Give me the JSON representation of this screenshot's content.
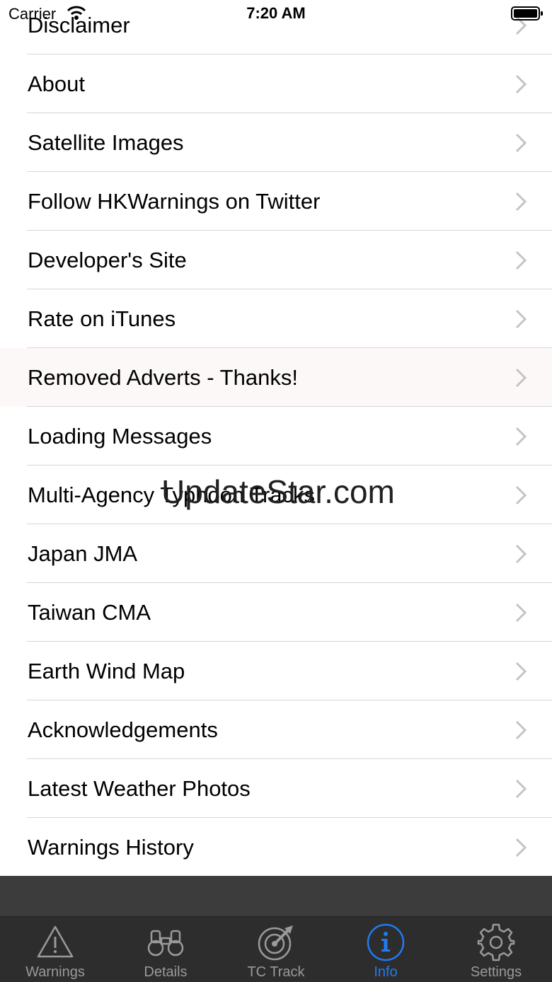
{
  "status_bar": {
    "carrier": "Carrier",
    "time": "7:20 AM"
  },
  "menu": {
    "items": [
      {
        "label": "Disclaimer"
      },
      {
        "label": "About"
      },
      {
        "label": "Satellite Images"
      },
      {
        "label": "Follow HKWarnings on Twitter"
      },
      {
        "label": "Developer's Site"
      },
      {
        "label": "Rate on iTunes"
      },
      {
        "label": "Removed Adverts - Thanks!"
      },
      {
        "label": "Loading Messages"
      },
      {
        "label": "Multi-Agency Typhoon Tracks"
      },
      {
        "label": "Japan JMA"
      },
      {
        "label": "Taiwan CMA"
      },
      {
        "label": "Earth Wind Map"
      },
      {
        "label": "Acknowledgements"
      },
      {
        "label": "Latest Weather Photos"
      },
      {
        "label": "Warnings History"
      }
    ]
  },
  "watermark": "UpdateStar.com",
  "tabbar": {
    "active": "Info",
    "active_color": "#1f7bf2",
    "tabs": [
      {
        "label": "Warnings",
        "icon": "warning-triangle-icon"
      },
      {
        "label": "Details",
        "icon": "binoculars-icon"
      },
      {
        "label": "TC Track",
        "icon": "radar-icon"
      },
      {
        "label": "Info",
        "icon": "info-circle-icon"
      },
      {
        "label": "Settings",
        "icon": "gear-icon"
      }
    ]
  }
}
